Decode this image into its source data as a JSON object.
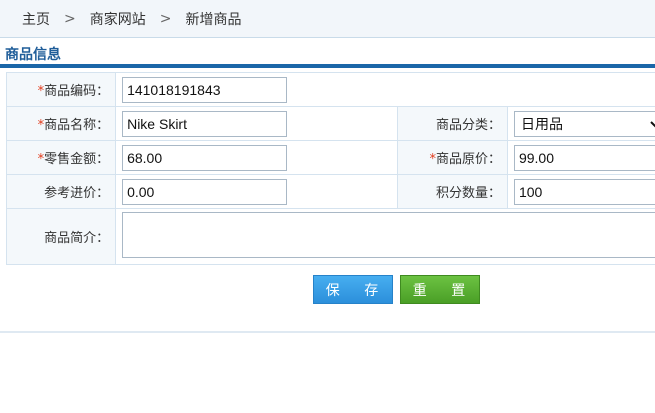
{
  "breadcrumb": {
    "items": [
      "主页",
      "商家网站",
      "新增商品"
    ],
    "separator": ">"
  },
  "section": {
    "title": "商品信息"
  },
  "form": {
    "required_mark": "*",
    "product_code": {
      "label": "商品编码：",
      "value": "141018191843"
    },
    "product_name": {
      "label": "商品名称：",
      "value": "Nike Skirt"
    },
    "category": {
      "label": "商品分类：",
      "value": "日用品"
    },
    "retail_price": {
      "label": "零售金额：",
      "value": "68.00"
    },
    "original_price": {
      "label": "商品原价：",
      "value": "99.00"
    },
    "ref_cost": {
      "label": "参考进价：",
      "value": "0.00"
    },
    "points": {
      "label": "积分数量：",
      "value": "100"
    },
    "description": {
      "label": "商品简介：",
      "value": ""
    }
  },
  "buttons": {
    "save": "保 存",
    "reset": "重 置"
  },
  "colors": {
    "accent": "#1a66a8",
    "save": "#2c8fdb",
    "reset": "#4a9f26",
    "required": "#e23b1b"
  }
}
